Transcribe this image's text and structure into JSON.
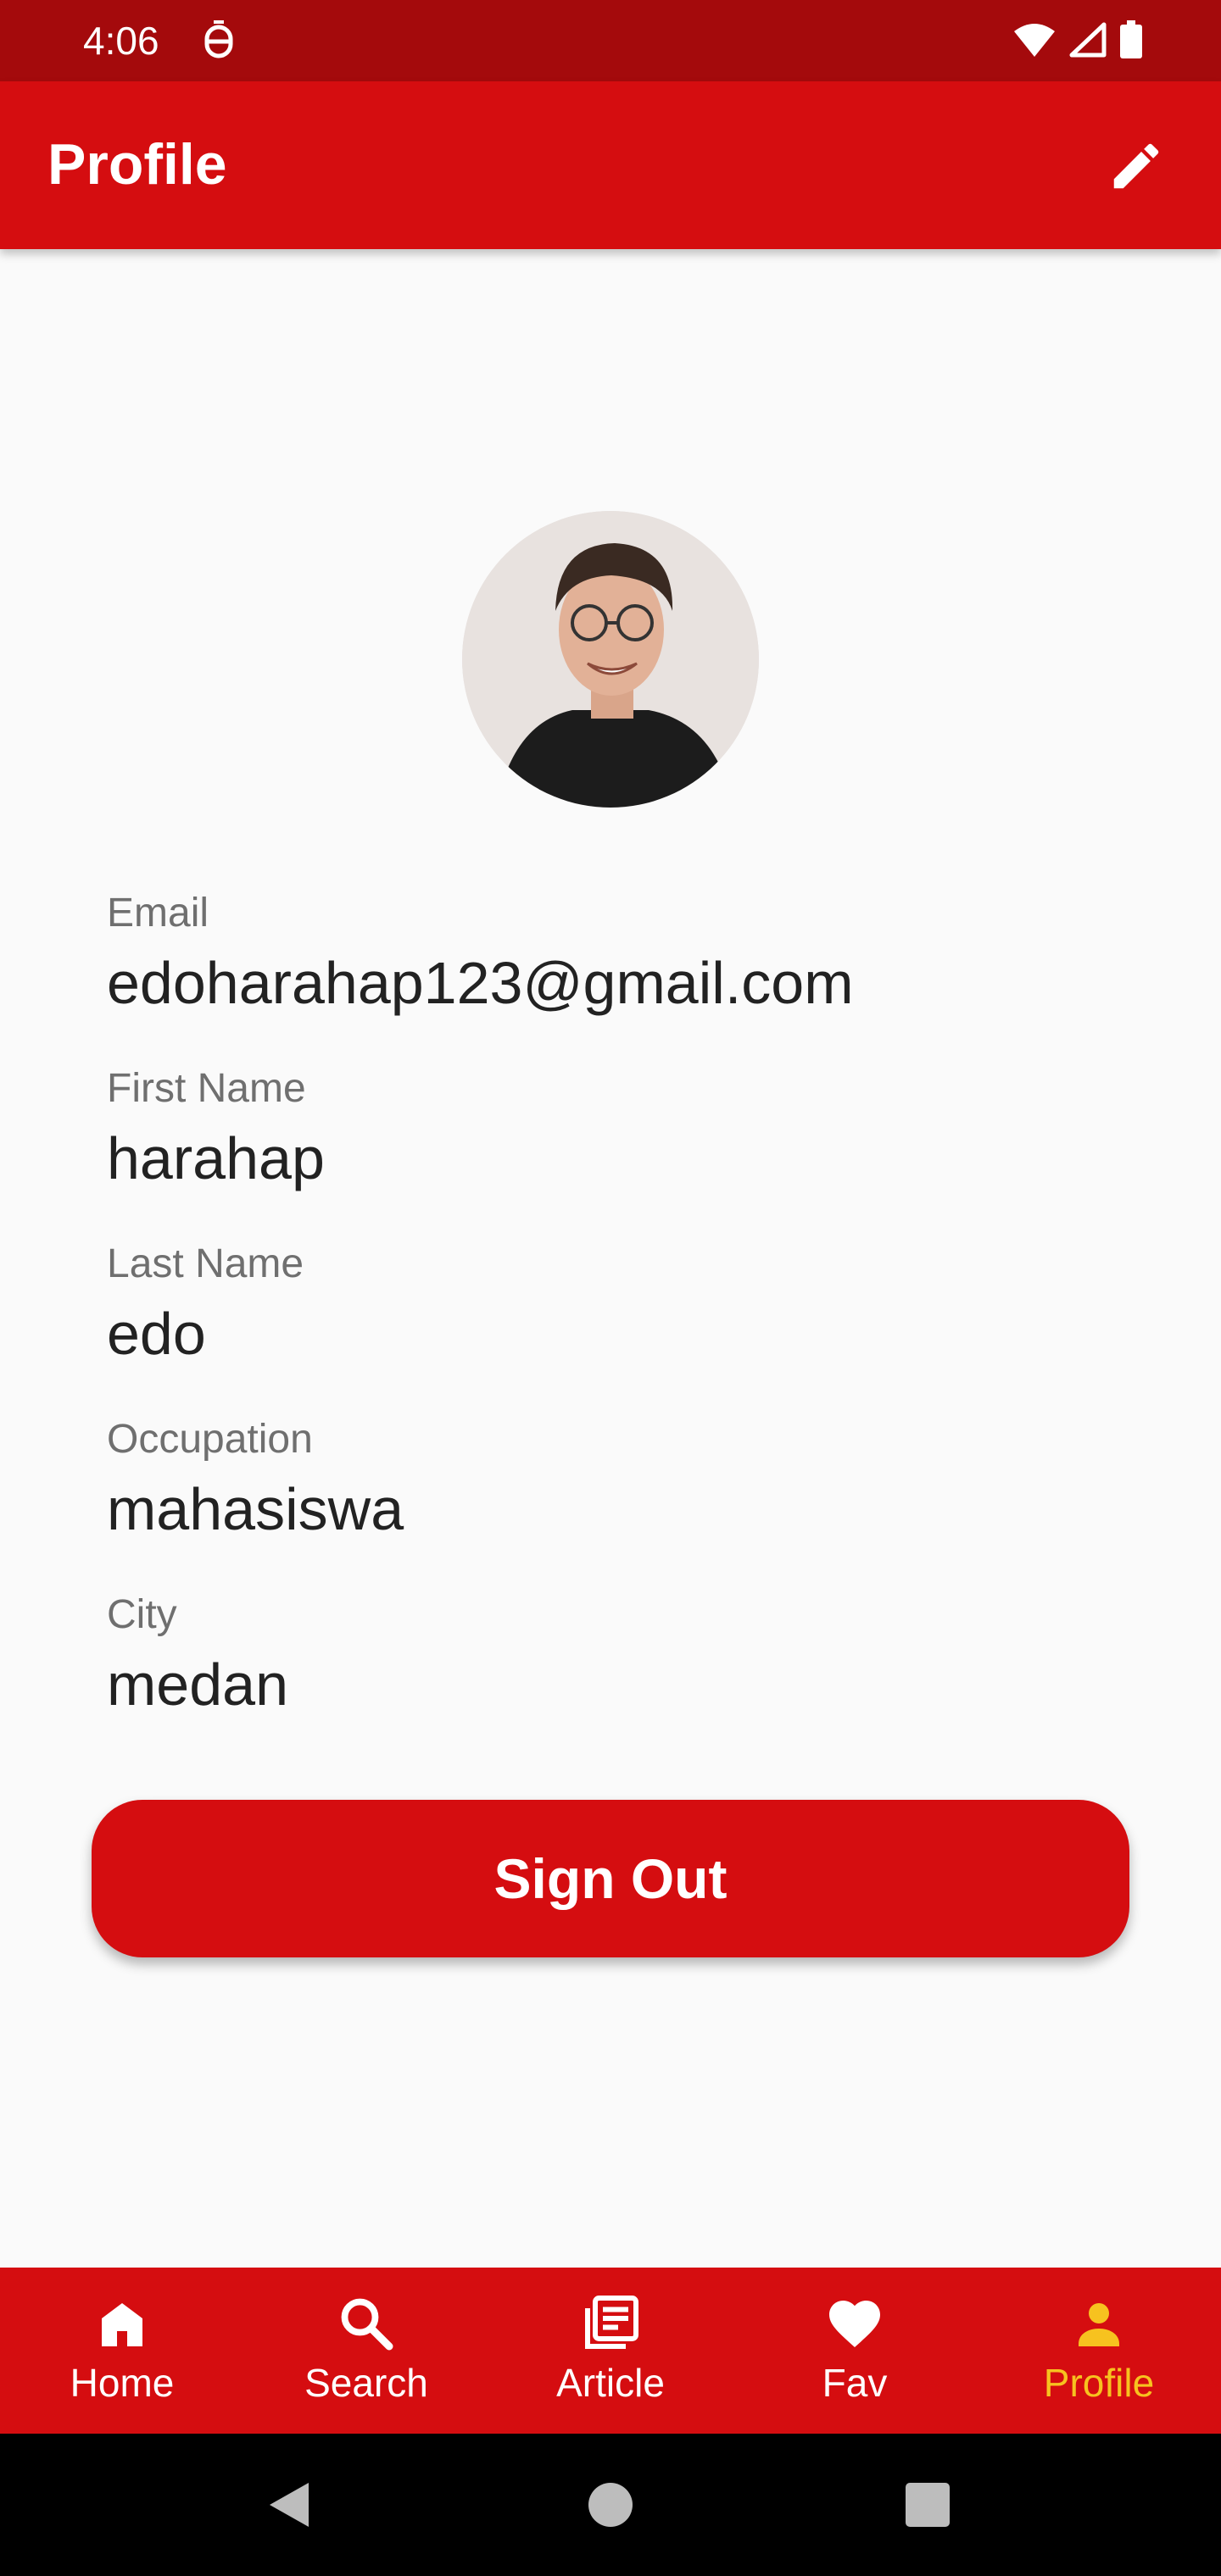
{
  "status_bar": {
    "time": "4:06",
    "left_icon": "notification-icon",
    "right_icons": [
      "wifi-icon",
      "cell-signal-icon",
      "battery-icon"
    ]
  },
  "app_bar": {
    "title": "Profile",
    "action_icon": "edit-pencil-icon"
  },
  "avatar": {
    "alt": "profile photo"
  },
  "fields": [
    {
      "label": "Email",
      "value": "edoharahap123@gmail.com"
    },
    {
      "label": "First Name",
      "value": "harahap"
    },
    {
      "label": "Last Name",
      "value": "edo"
    },
    {
      "label": "Occupation",
      "value": "mahasiswa"
    },
    {
      "label": "City",
      "value": "medan"
    }
  ],
  "sign_out_label": "Sign Out",
  "bottom_nav": {
    "items": [
      {
        "label": "Home",
        "icon": "home-icon",
        "active": false
      },
      {
        "label": "Search",
        "icon": "search-icon",
        "active": false
      },
      {
        "label": "Article",
        "icon": "article-icon",
        "active": false
      },
      {
        "label": "Fav",
        "icon": "heart-icon",
        "active": false
      },
      {
        "label": "Profile",
        "icon": "person-icon",
        "active": true
      }
    ]
  },
  "colors": {
    "status_bar": "#a40a0c",
    "primary": "#d50d10",
    "active_nav": "#f7c21f",
    "background": "#fafafa"
  },
  "system_nav": [
    "back-icon",
    "home-circle-icon",
    "recents-square-icon"
  ]
}
